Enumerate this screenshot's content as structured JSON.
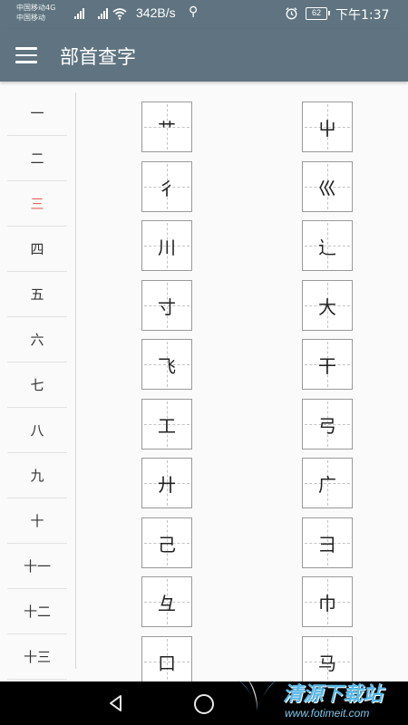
{
  "status_bar": {
    "carrier_line1": "中国移动4G",
    "carrier_line2": "中国移动",
    "network_badge": "4G",
    "net_speed": "342B/s",
    "usb_icon": "usb-icon",
    "battery_level": "62",
    "time": "下午1:37"
  },
  "toolbar": {
    "title": "部首查字"
  },
  "stroke_counts": {
    "items": [
      "一",
      "二",
      "三",
      "四",
      "五",
      "六",
      "七",
      "八",
      "九",
      "十",
      "十一",
      "十二",
      "十三"
    ],
    "selected": "三",
    "selected_color": "#e0665c"
  },
  "radicals": {
    "left_column": [
      "艹",
      "彳",
      "川",
      "寸",
      "飞",
      "工",
      "廾",
      "己",
      "彑",
      "口"
    ],
    "right_column": [
      "屮",
      "巛",
      "辶",
      "大",
      "干",
      "弓",
      "广",
      "彐",
      "巾",
      "马"
    ]
  },
  "nav_bar": {
    "back_icon": "triangle-back-icon",
    "home_icon": "circle-home-icon"
  },
  "watermark": {
    "brand": "清源下载站",
    "url": "www.fotimeit.com"
  },
  "colors": {
    "app_bar": "#5f7480",
    "background": "#fafafa",
    "nav_bar": "#000000"
  }
}
